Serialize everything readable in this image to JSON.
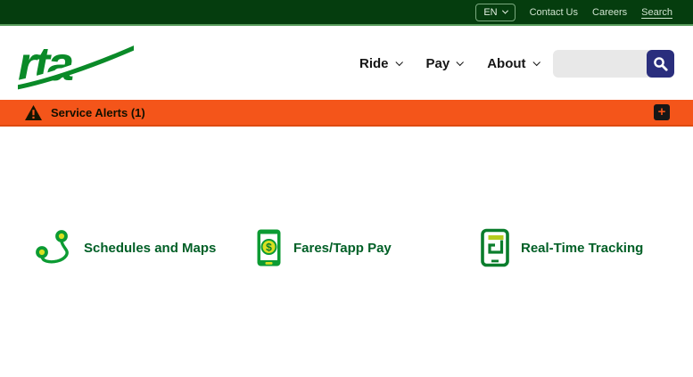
{
  "topbar": {
    "language": {
      "label": "EN"
    },
    "links": {
      "contact": "Contact Us",
      "careers": "Careers",
      "search": "Search"
    }
  },
  "header": {
    "logo_text": "rta",
    "nav": [
      {
        "label": "Ride"
      },
      {
        "label": "Pay"
      },
      {
        "label": "About"
      }
    ],
    "search": {
      "value": "",
      "placeholder": ""
    }
  },
  "alerts": {
    "label": "Service Alerts (1)",
    "count": "1",
    "expand_label": "+"
  },
  "features": [
    {
      "label": "Schedules and Maps",
      "icon": "route-map-icon"
    },
    {
      "label": "Fares/Tapp Pay",
      "icon": "mobile-payment-icon",
      "currency_symbol": "$"
    },
    {
      "label": "Real-Time Tracking",
      "icon": "tracking-device-icon"
    }
  ],
  "colors": {
    "topbar_green": "#053d0e",
    "divider_green": "#569a5a",
    "brand_green": "#0a8a28",
    "icon_green": "#0c9b33",
    "accent_yellow": "#d9e021",
    "alert_orange": "#f4551a",
    "search_navy": "#2a2e7d",
    "feature_text_green": "#005f26"
  }
}
